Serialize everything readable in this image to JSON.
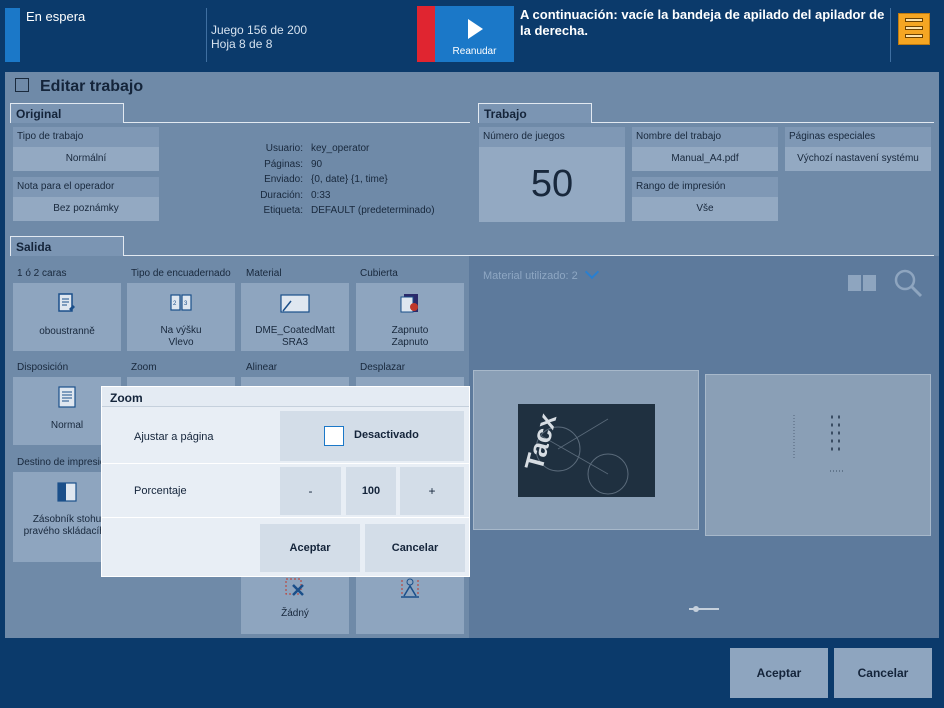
{
  "topbar": {
    "status": "En espera",
    "job_count": "Juego 156 de 200",
    "sheet_count": "Hoja 8 de 8",
    "resume_label": "Reanudar",
    "next_message": "A continuación: vacíe la bandeja de apilado del apilador de la derecha."
  },
  "page": {
    "title": "Editar trabajo"
  },
  "original": {
    "tab": "Original",
    "job_type_label": "Tipo de trabajo",
    "job_type_value": "Normální",
    "operator_note_label": "Nota para el operador",
    "operator_note_value": "Bez poznámky",
    "info": [
      {
        "key": "Usuario:",
        "value": "key_operator"
      },
      {
        "key": "Páginas:",
        "value": "90"
      },
      {
        "key": "Enviado:",
        "value": "{0, date} {1, time}"
      },
      {
        "key": "Duración:",
        "value": "0:33"
      },
      {
        "key": "Etiqueta:",
        "value": "DEFAULT (predeterminado)"
      }
    ]
  },
  "trabajo": {
    "tab": "Trabajo",
    "sets_label": "Número de juegos",
    "sets_value": "50",
    "job_name_label": "Nombre del trabajo",
    "job_name_value": "Manual_A4.pdf",
    "print_range_label": "Rango de impresión",
    "print_range_value": "Vše",
    "special_pages_label": "Páginas especiales",
    "special_pages_value": "Výchozí nastavení systému"
  },
  "salida": {
    "tab": "Salida",
    "sides_label": "1 ó 2 caras",
    "sides_value": "oboustranně",
    "binding_label": "Tipo de encuadernado",
    "binding_value_1": "Na výšku",
    "binding_value_2": "Vlevo",
    "material_label": "Material",
    "material_value_1": "DME_CoatedMatt",
    "material_value_2": "SRA3",
    "cover_label": "Cubierta",
    "cover_value_1": "Zapnuto",
    "cover_value_2": "Zapnuto",
    "layout_label": "Disposición",
    "layout_value": "Normal",
    "zoom_label": "Zoom",
    "align_label": "Alinear",
    "shift_label": "Desplazar",
    "destination_label": "Destino de impresión",
    "destination_value_1": "Zásobník stohu",
    "destination_value_2": "pravého skládacího",
    "finishing_value": "Žádný"
  },
  "preview": {
    "material_used": "Material utilizado: 2"
  },
  "zoom_dialog": {
    "title": "Zoom",
    "fit_label": "Ajustar a página",
    "fit_value": "Desactivado",
    "percent_label": "Porcentaje",
    "minus": "-",
    "percent_value": "100",
    "plus": "+",
    "accept": "Aceptar",
    "cancel": "Cancelar"
  },
  "bottom": {
    "accept": "Aceptar",
    "cancel": "Cancelar"
  },
  "colors": {
    "accent": "#1b78c8",
    "alert": "#e02530",
    "stacker": "#f5a623"
  }
}
